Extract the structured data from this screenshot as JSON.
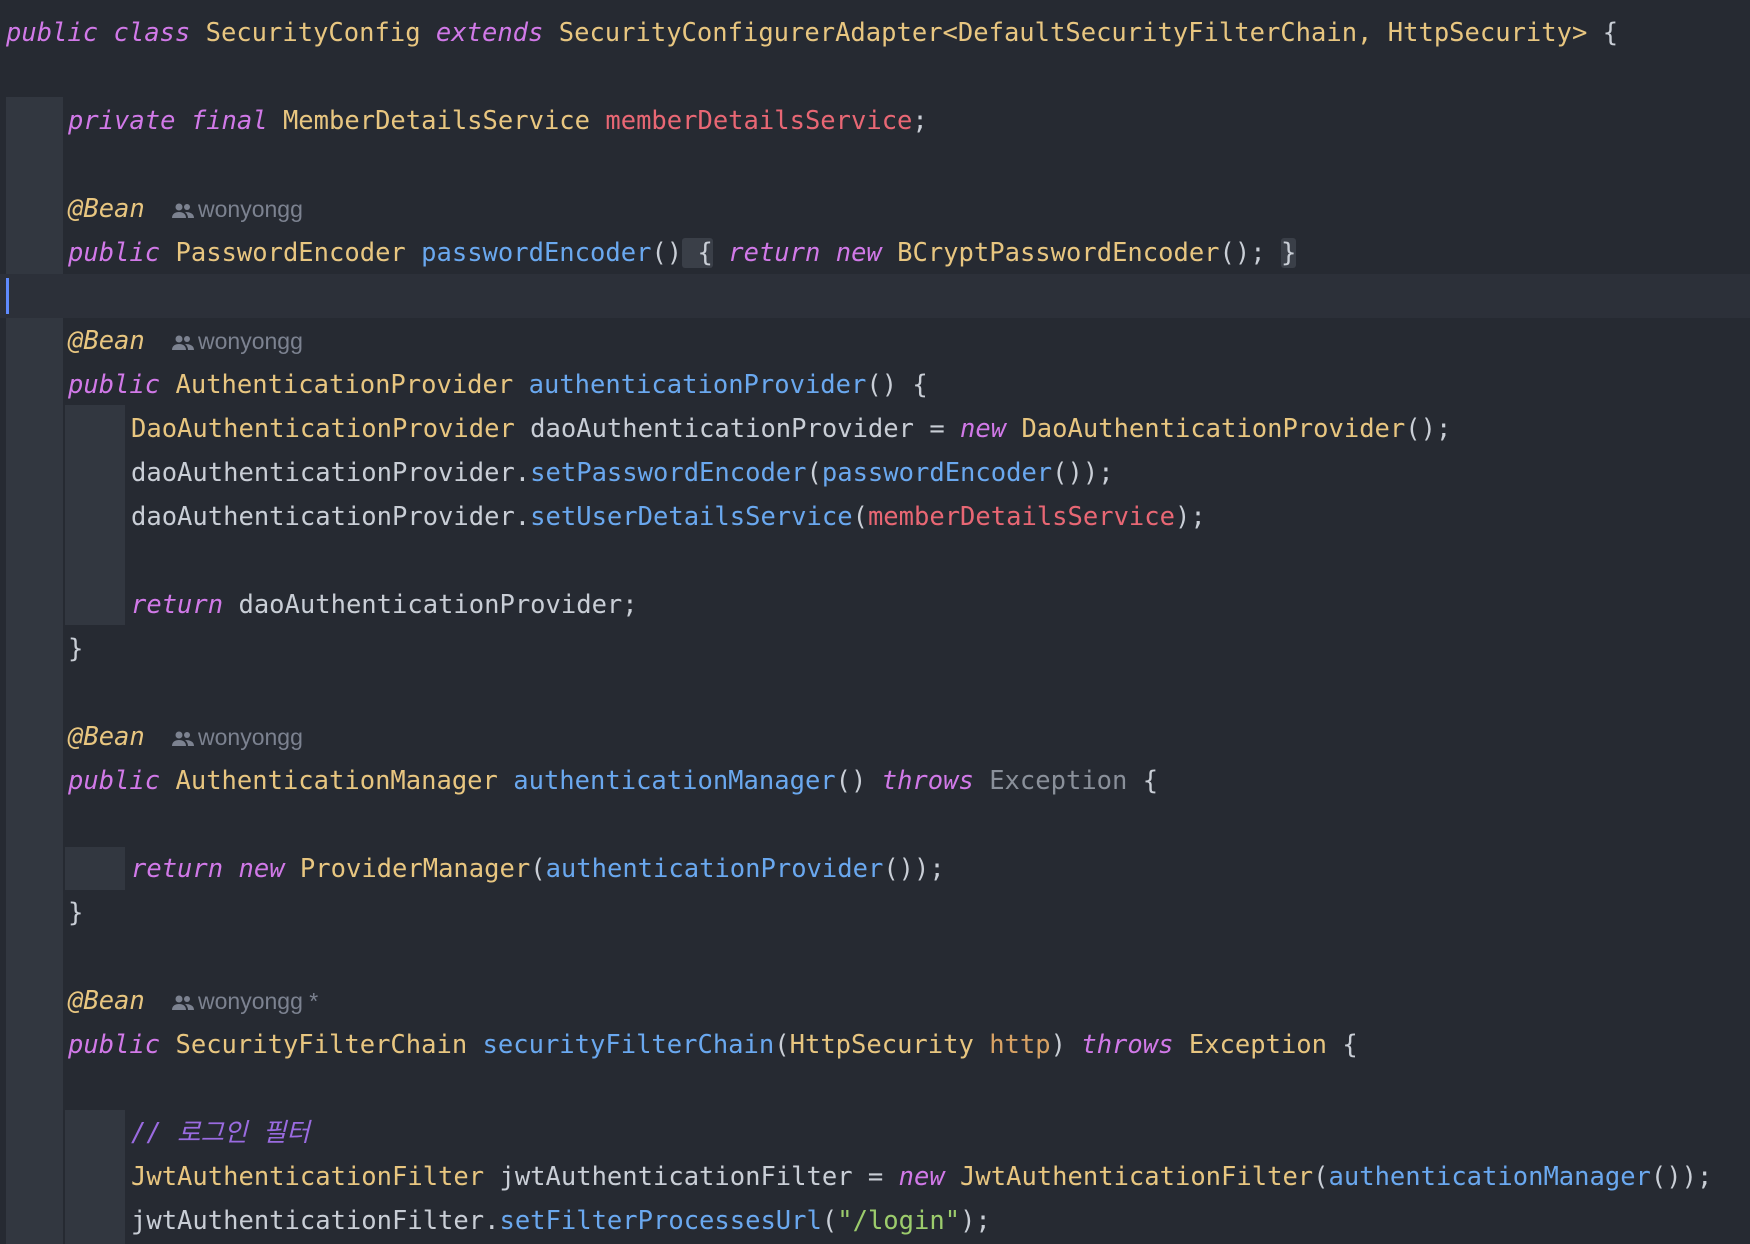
{
  "code": {
    "class_line": {
      "kw1": "public",
      "kw2": "class",
      "class_name": "SecurityConfig",
      "kw3": "extends",
      "parent": "SecurityConfigurerAdapter<DefaultSecurityFilterChain, HttpSecurity>",
      "brace": " {"
    },
    "field_line": {
      "kw1": "private",
      "kw2": "final",
      "type": "MemberDetailsService",
      "name": "memberDetailsService",
      "end": ";"
    },
    "bean1": {
      "annotation": "@Bean",
      "author": "wonyongg",
      "kw": "public",
      "type": "PasswordEncoder",
      "name": "passwordEncoder",
      "parens": "()",
      "open": " {",
      "ret": "return",
      "new": "new",
      "ctor": "BCryptPasswordEncoder",
      "tail": "(); ",
      "close": "}"
    },
    "bean2": {
      "annotation": "@Bean",
      "author": "wonyongg",
      "kw": "public",
      "type": "AuthenticationProvider",
      "name": "authenticationProvider",
      "sig_tail": "() {",
      "l1_type": "DaoAuthenticationProvider",
      "l1_var": " daoAuthenticationProvider = ",
      "l1_new": "new",
      "l1_ctor": "DaoAuthenticationProvider",
      "l1_end": "();",
      "l2_obj": "daoAuthenticationProvider.",
      "l2_method": "setPasswordEncoder",
      "l2_open": "(",
      "l2_arg": "passwordEncoder",
      "l2_end": "());",
      "l3_obj": "daoAuthenticationProvider.",
      "l3_method": "setUserDetailsService",
      "l3_open": "(",
      "l3_arg": "memberDetailsService",
      "l3_end": ");",
      "ret": "return",
      "ret_val": " daoAuthenticationProvider;",
      "close": "}"
    },
    "bean3": {
      "annotation": "@Bean",
      "author": "wonyongg",
      "kw": "public",
      "type": "AuthenticationManager",
      "name": "authenticationManager",
      "parens": "() ",
      "throws": "throws",
      "exception": "Exception",
      "open": " {",
      "ret": "return",
      "new": "new",
      "ctor": "ProviderManager",
      "paren_open": "(",
      "arg": "authenticationProvider",
      "end": "());",
      "close": "}"
    },
    "bean4": {
      "annotation": "@Bean",
      "author": "wonyongg *",
      "kw": "public",
      "type": "SecurityFilterChain",
      "name": "securityFilterChain",
      "paren_open": "(",
      "param_type": "HttpSecurity",
      "param": "http",
      "paren_close": ") ",
      "throws": "throws",
      "exception": "Exception",
      "open": " {",
      "comment": "// 로그인 필터",
      "l1_type": "JwtAuthenticationFilter",
      "l1_var": " jwtAuthenticationFilter = ",
      "l1_new": "new",
      "l1_ctor": "JwtAuthenticationFilter",
      "l1_open": "(",
      "l1_arg": "authenticationManager",
      "l1_end": "());",
      "l2_obj": "jwtAuthenticationFilter.",
      "l2_method": "setFilterProcessesUrl",
      "l2_open": "(",
      "l2_str": "\"/login\"",
      "l2_end": ");"
    }
  },
  "colors": {
    "background": "#262a32",
    "keyword": "#d179e8",
    "type": "#e8c680",
    "method": "#6aa8ef",
    "field": "#e86774",
    "default": "#c9ced6",
    "caret": "#5f8bff",
    "author": "#7c8290"
  },
  "icons": {
    "author": "people-icon"
  }
}
